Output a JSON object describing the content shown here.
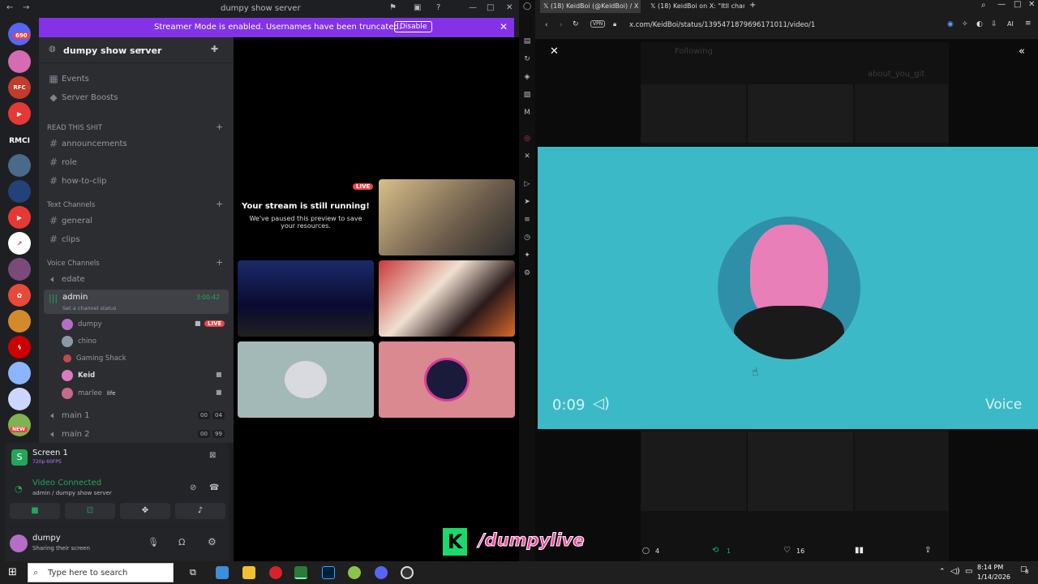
{
  "discord": {
    "window_title": "dumpy show server",
    "guild_badge": "690",
    "guild_labels": {
      "rmci": "RMCI",
      "new": "NEW"
    },
    "streamer_mode": {
      "message": "Streamer Mode is enabled. Usernames have been truncated.",
      "disable_label": "Disable"
    },
    "server_name": "dumpy show server",
    "top_items": [
      "Events",
      "Server Boosts"
    ],
    "categories": {
      "read": "READ THIS SHIT",
      "text": "Text Channels",
      "voice": "Voice Channels"
    },
    "read_channels": [
      "announcements",
      "role",
      "how-to-clip"
    ],
    "text_channels": [
      "general",
      "clips"
    ],
    "voice_channels": {
      "edate": "edate",
      "admin": "admin",
      "admin_timer": "3:00:42",
      "admin_status": "Set a channel status",
      "main1": "main 1",
      "main1_counts": [
        "00",
        "04"
      ],
      "main2": "main 2",
      "main2_counts": [
        "00",
        "99"
      ]
    },
    "voice_users": [
      {
        "name": "dumpy",
        "live": "LIVE"
      },
      {
        "name": "chino"
      },
      {
        "name": "Gaming Shack"
      },
      {
        "name": "Keid"
      },
      {
        "name": "marlee",
        "tag": "life"
      }
    ],
    "panel": {
      "screen_title": "Screen 1",
      "screen_quality": "720p 60FPS",
      "connected_title": "Video Connected",
      "connected_sub": "admin / dumpy show server",
      "username": "dumpy",
      "user_status": "Sharing their screen"
    },
    "stage": {
      "live_badge": "LIVE",
      "paused_title": "Your stream is still running!",
      "paused_body": "We've paused this preview to save your resources."
    }
  },
  "browser": {
    "tabs": [
      "(18) KeidBoi (@KeidBoi) / X",
      "(18) KeidBoi on X: \"Itll char"
    ],
    "vpn_label": "VPN",
    "url": "x.com/KeidBoi/status/1395471879696171011/video/1",
    "ai_label": "AI",
    "video": {
      "time": "0:09",
      "caption": "Voice"
    },
    "actions": {
      "replies": "4",
      "reposts": "1",
      "likes": "16"
    },
    "background_text": {
      "following": "Following",
      "about": "about_you_git"
    }
  },
  "overlay": {
    "brand": "/dumpylive"
  },
  "taskbar": {
    "search_placeholder": "Type here to search",
    "time": "8:14 PM",
    "date": "1/14/2026",
    "notif_count": "8"
  },
  "colors": {
    "discord_bg": "#1e1f22",
    "channels_bg": "#2b2d31",
    "streamer_purple": "#8332e8",
    "video_teal": "#3cb9c6",
    "live_red": "#ed4245",
    "connected_green": "#23a55a"
  }
}
